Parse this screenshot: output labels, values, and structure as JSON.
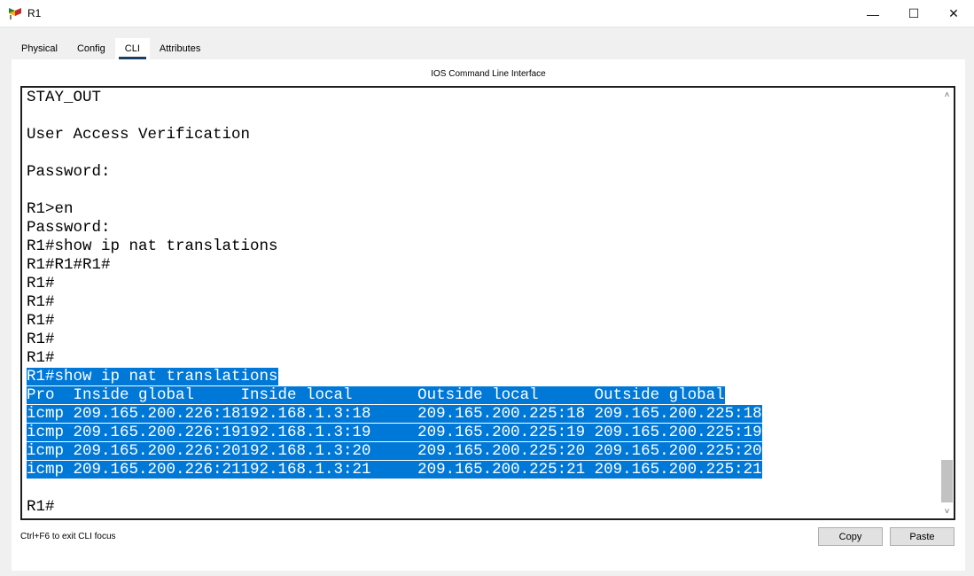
{
  "window": {
    "title": "R1",
    "minimize_glyph": "—",
    "maximize_glyph": "☐",
    "close_glyph": "✕"
  },
  "tabs": [
    {
      "label": "Physical",
      "active": false
    },
    {
      "label": "Config",
      "active": false
    },
    {
      "label": "CLI",
      "active": true
    },
    {
      "label": "Attributes",
      "active": false
    }
  ],
  "panel": {
    "title": "IOS Command Line Interface"
  },
  "console": {
    "lines": [
      {
        "text": "STAY_OUT",
        "highlighted": false
      },
      {
        "text": "",
        "highlighted": false
      },
      {
        "text": "User Access Verification",
        "highlighted": false
      },
      {
        "text": "",
        "highlighted": false
      },
      {
        "text": "Password:",
        "highlighted": false
      },
      {
        "text": "",
        "highlighted": false
      },
      {
        "text": "R1>en",
        "highlighted": false
      },
      {
        "text": "Password:",
        "highlighted": false
      },
      {
        "text": "R1#show ip nat translations",
        "highlighted": false
      },
      {
        "text": "R1#R1#R1#",
        "highlighted": false
      },
      {
        "text": "R1#",
        "highlighted": false
      },
      {
        "text": "R1#",
        "highlighted": false
      },
      {
        "text": "R1#",
        "highlighted": false
      },
      {
        "text": "R1#",
        "highlighted": false
      },
      {
        "text": "R1#",
        "highlighted": false
      },
      {
        "text": "R1#show ip nat translations",
        "highlighted": true
      },
      {
        "text": "Pro  Inside global     Inside local       Outside local      Outside global",
        "highlighted": true
      },
      {
        "text": "icmp 209.165.200.226:18192.168.1.3:18     209.165.200.225:18 209.165.200.225:18",
        "highlighted": true
      },
      {
        "text": "icmp 209.165.200.226:19192.168.1.3:19     209.165.200.225:19 209.165.200.225:19",
        "highlighted": true
      },
      {
        "text": "icmp 209.165.200.226:20192.168.1.3:20     209.165.200.225:20 209.165.200.225:20",
        "highlighted": true
      },
      {
        "text": "icmp 209.165.200.226:21192.168.1.3:21     209.165.200.225:21 209.165.200.225:21",
        "highlighted": true
      },
      {
        "text": "",
        "highlighted": false
      },
      {
        "text": "R1#",
        "highlighted": false
      }
    ],
    "scroll_up_glyph": "˄",
    "scroll_down_glyph": "˅"
  },
  "footer": {
    "hint": "Ctrl+F6 to exit CLI focus",
    "copy_label": "Copy",
    "paste_label": "Paste"
  },
  "colors": {
    "selection": "#0078d7",
    "active_tab_indicator": "#1a3f64"
  }
}
